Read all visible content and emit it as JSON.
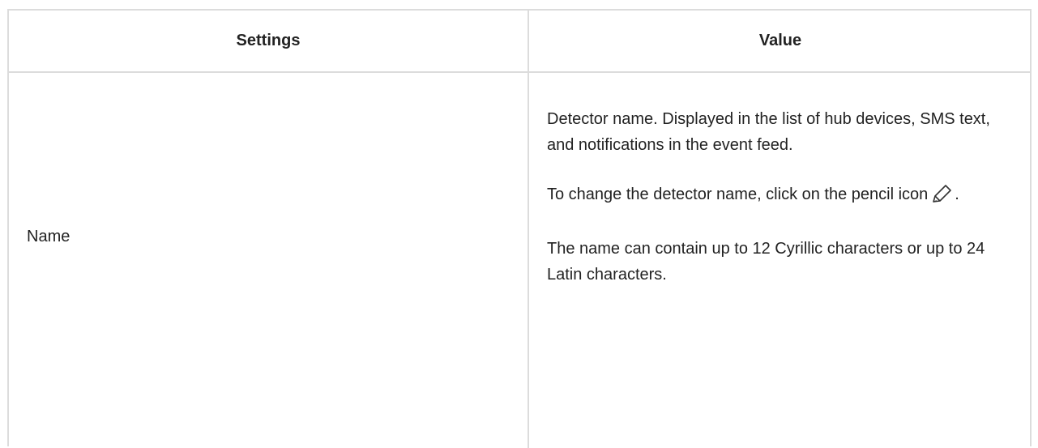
{
  "table": {
    "headers": {
      "settings": "Settings",
      "value": "Value"
    },
    "rows": [
      {
        "setting": "Name",
        "value": {
          "paragraph_1": "Detector name. Displayed in the list of hub devices, SMS text, and notifications in the event feed.",
          "paragraph_2_before_icon": "To change the detector name, click on the pencil icon",
          "paragraph_2_icon": "pencil-icon",
          "paragraph_2_after_icon": ".",
          "paragraph_3": "The name can contain up to 12 Cyrillic characters or up to 24 Latin characters."
        }
      }
    ]
  }
}
